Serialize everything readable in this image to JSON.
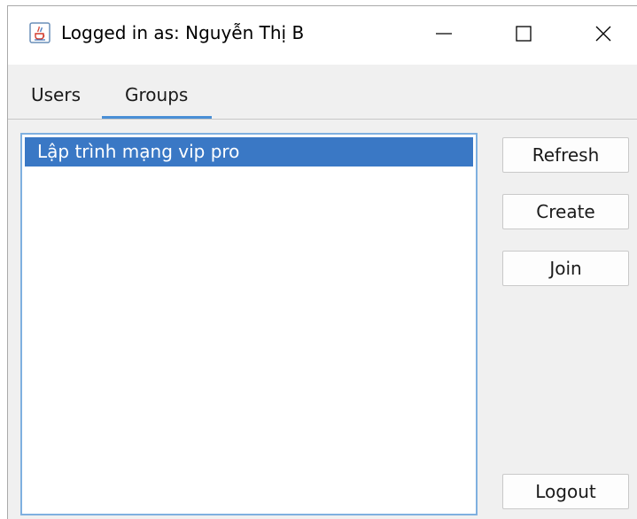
{
  "window": {
    "title": "Logged in as: Nguyễn Thị B"
  },
  "tabs": [
    {
      "label": "Users",
      "selected": false
    },
    {
      "label": "Groups",
      "selected": true
    }
  ],
  "groups_list": {
    "items": [
      "Lập trình mạng vip pro"
    ],
    "selected_index": 0
  },
  "buttons": {
    "refresh": "Refresh",
    "create": "Create",
    "join": "Join",
    "logout": "Logout"
  },
  "colors": {
    "selection": "#3a78c5",
    "accent": "#4a8fd6",
    "list_border": "#7fb0e0"
  },
  "icons": {
    "app": "java-cup-icon",
    "minimize": "minimize-icon",
    "maximize": "maximize-icon",
    "close": "close-icon"
  }
}
